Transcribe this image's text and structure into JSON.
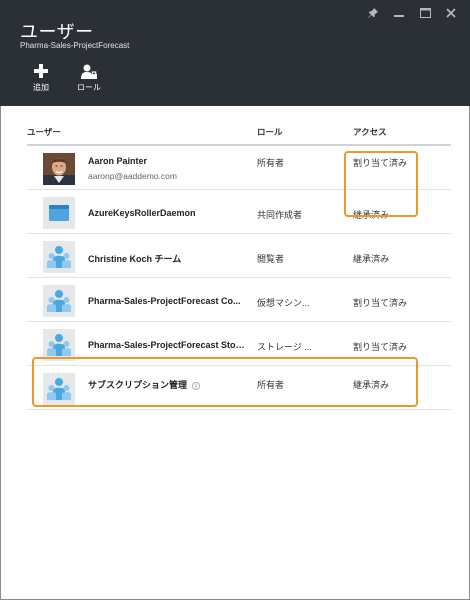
{
  "window": {
    "controls": [
      "pin-icon",
      "minimize-icon",
      "maximize-icon",
      "close-icon"
    ]
  },
  "header": {
    "title": "ユーザー",
    "subtitle": "Pharma-Sales-ProjectForecast"
  },
  "commands": {
    "add_label": "追加",
    "role_label": "ロール"
  },
  "grid": {
    "columns": {
      "user": "ユーザー",
      "role": "ロール",
      "access": "アクセス"
    },
    "rows": [
      {
        "name": "Aaron Painter",
        "email": "aaronp@aaddemo.com",
        "role": "所有者",
        "access": "割り当て済み",
        "avatar": "person-photo"
      },
      {
        "name": "AzureKeysRollerDaemon",
        "role": "共同作成者",
        "access": "継承済み",
        "avatar": "app-icon"
      },
      {
        "name": "Christine Koch チーム",
        "role": "閲覧者",
        "access": "継承済み",
        "avatar": "group-icon"
      },
      {
        "name": "Pharma-Sales-ProjectForecast Co...",
        "role": "仮想マシン...",
        "access": "割り当て済み",
        "avatar": "group-icon"
      },
      {
        "name": "Pharma-Sales-ProjectForecast Stor...",
        "role": "ストレージ ...",
        "access": "割り当て済み",
        "avatar": "group-icon"
      },
      {
        "name": "サブスクリプション管理",
        "role": "所有者",
        "access": "継承済み",
        "avatar": "group-icon",
        "info": "info-icon"
      }
    ]
  },
  "highlight_color": "#f0962a",
  "header_color": "#2b2f36"
}
